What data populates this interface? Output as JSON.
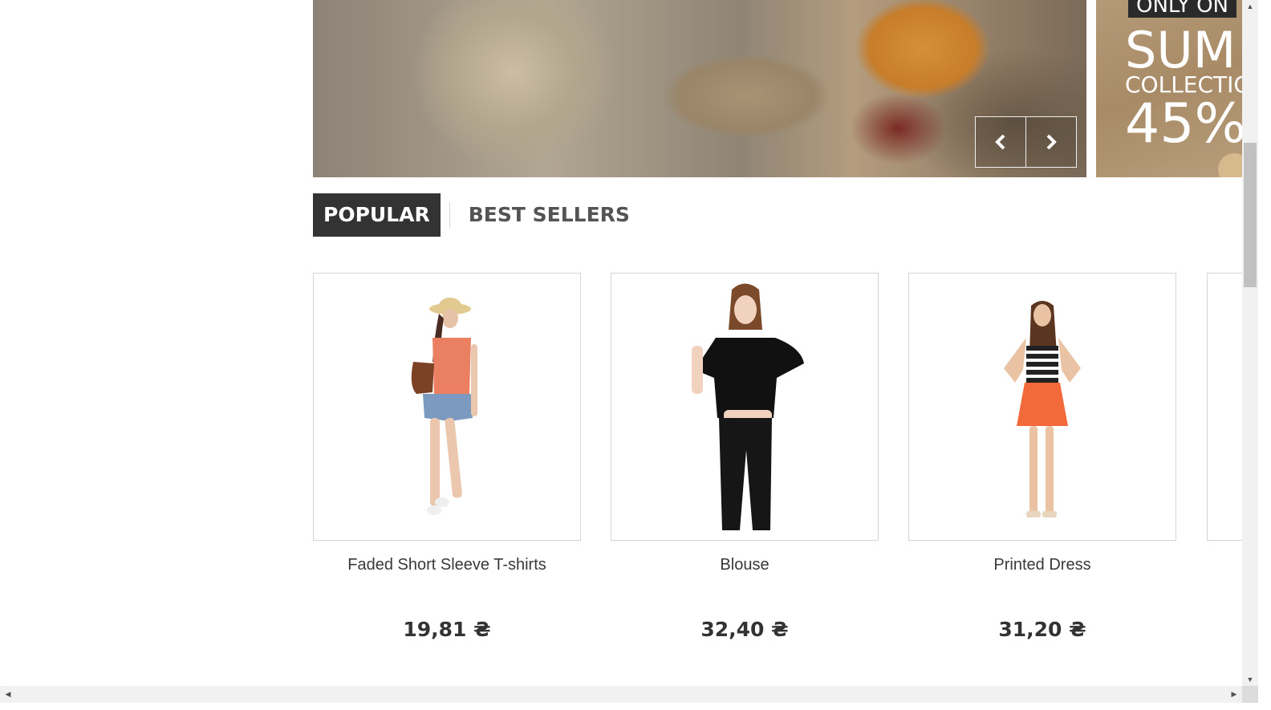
{
  "slider": {
    "prev_icon": "chevron-left-icon",
    "next_icon": "chevron-right-icon"
  },
  "promo": {
    "tag": "ONLY ON",
    "headline": "SUM",
    "subline": "COLLECTIO",
    "discount": "45%"
  },
  "tabs": [
    {
      "label": "POPULAR",
      "active": true
    },
    {
      "label": "BEST SELLERS",
      "active": false
    }
  ],
  "products": [
    {
      "name": "Faded Short Sleeve T-shirts",
      "price": "19,81 ₴"
    },
    {
      "name": "Blouse",
      "price": "32,40 ₴"
    },
    {
      "name": "Printed Dress",
      "price": "31,20 ₴"
    }
  ],
  "colors": {
    "tab_active_bg": "#333333",
    "border": "#d6d4d4"
  }
}
